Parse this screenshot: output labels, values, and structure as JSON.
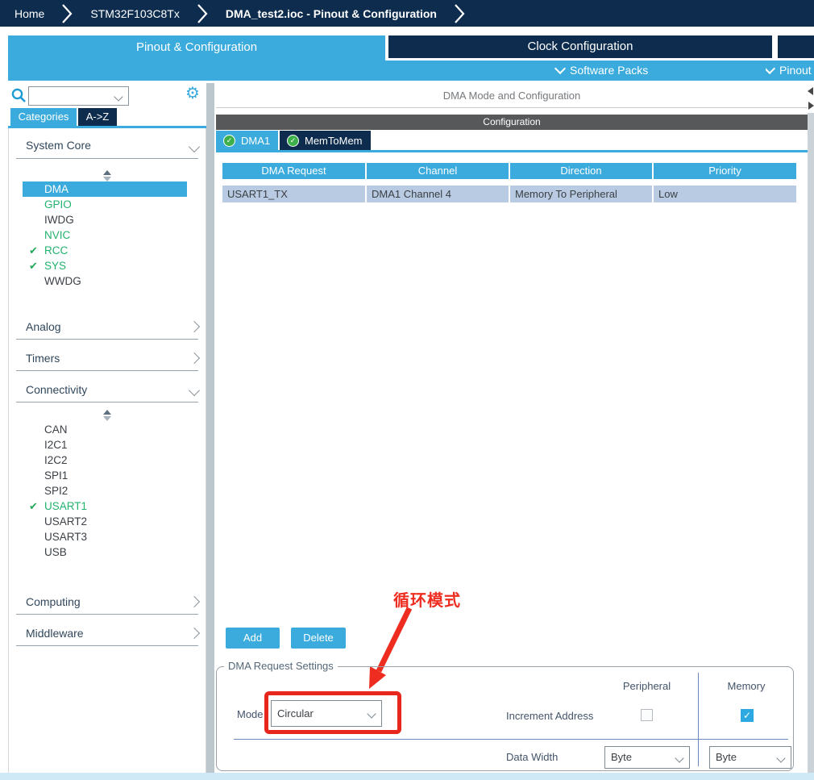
{
  "breadcrumb": {
    "items": [
      "Home",
      "STM32F103C8Tx",
      "DMA_test2.ioc - Pinout & Configuration"
    ]
  },
  "top_tabs": {
    "pinout": "Pinout & Configuration",
    "clock": "Clock Configuration",
    "software_packs": "Software Packs",
    "pinout_menu": "Pinout"
  },
  "sidebar": {
    "search": {
      "value": "",
      "placeholder": ""
    },
    "tabs": {
      "categories": "Categories",
      "az": "A->Z"
    },
    "sections": [
      {
        "label": "System Core",
        "expanded": true,
        "items": [
          {
            "label": "DMA",
            "state": "selected"
          },
          {
            "label": "GPIO",
            "state": "green"
          },
          {
            "label": "IWDG",
            "state": "normal"
          },
          {
            "label": "NVIC",
            "state": "green"
          },
          {
            "label": "RCC",
            "state": "checked"
          },
          {
            "label": "SYS",
            "state": "checked"
          },
          {
            "label": "WWDG",
            "state": "normal"
          }
        ]
      },
      {
        "label": "Analog",
        "expanded": false,
        "items": []
      },
      {
        "label": "Timers",
        "expanded": false,
        "items": []
      },
      {
        "label": "Connectivity",
        "expanded": true,
        "items": [
          {
            "label": "CAN",
            "state": "normal"
          },
          {
            "label": "I2C1",
            "state": "normal"
          },
          {
            "label": "I2C2",
            "state": "normal"
          },
          {
            "label": "SPI1",
            "state": "normal"
          },
          {
            "label": "SPI2",
            "state": "normal"
          },
          {
            "label": "USART1",
            "state": "checked"
          },
          {
            "label": "USART2",
            "state": "normal"
          },
          {
            "label": "USART3",
            "state": "normal"
          },
          {
            "label": "USB",
            "state": "normal"
          }
        ]
      },
      {
        "label": "Computing",
        "expanded": false,
        "items": []
      },
      {
        "label": "Middleware",
        "expanded": false,
        "items": []
      }
    ]
  },
  "main": {
    "panel_title": "DMA Mode and Configuration",
    "config_title": "Configuration",
    "tabs": [
      {
        "label": "DMA1",
        "active": true,
        "icon": "green-check-circle"
      },
      {
        "label": "MemToMem",
        "active": false,
        "icon": "green-check-circle"
      }
    ],
    "table": {
      "headers": [
        "DMA Request",
        "Channel",
        "Direction",
        "Priority"
      ],
      "rows": [
        [
          "USART1_TX",
          "DMA1 Channel 4",
          "Memory To Peripheral",
          "Low"
        ]
      ]
    },
    "buttons": {
      "add": "Add",
      "delete": "Delete"
    },
    "settings": {
      "legend": "DMA Request Settings",
      "col_peripheral": "Peripheral",
      "col_memory": "Memory",
      "mode_label": "Mode",
      "mode_value": "Circular",
      "increment_label": "Increment Address",
      "peripheral_increment_checked": false,
      "memory_increment_checked": true,
      "check_glyph": "✓",
      "data_width_label": "Data Width",
      "data_width_peripheral": "Byte",
      "data_width_memory": "Byte"
    },
    "annotation": {
      "text": "循环模式"
    }
  },
  "icons": {
    "search": "magnifier",
    "settings": "gear",
    "tab_status": "green-check-circle",
    "enabled_item": "green-checkmark",
    "collapse": "left-right-triangles"
  },
  "colors": {
    "accent_blue": "#3aabdc",
    "navy": "#0d2c4e",
    "config_bar_gray": "#57585a",
    "table_row_blue": "#b9cbe2",
    "enabled_green": "#23b26d",
    "check_green": "#24a85b",
    "tab_check_green": "#3db049",
    "annotation_red": "#ee2d20",
    "divider_steel": "#6b8cba"
  }
}
